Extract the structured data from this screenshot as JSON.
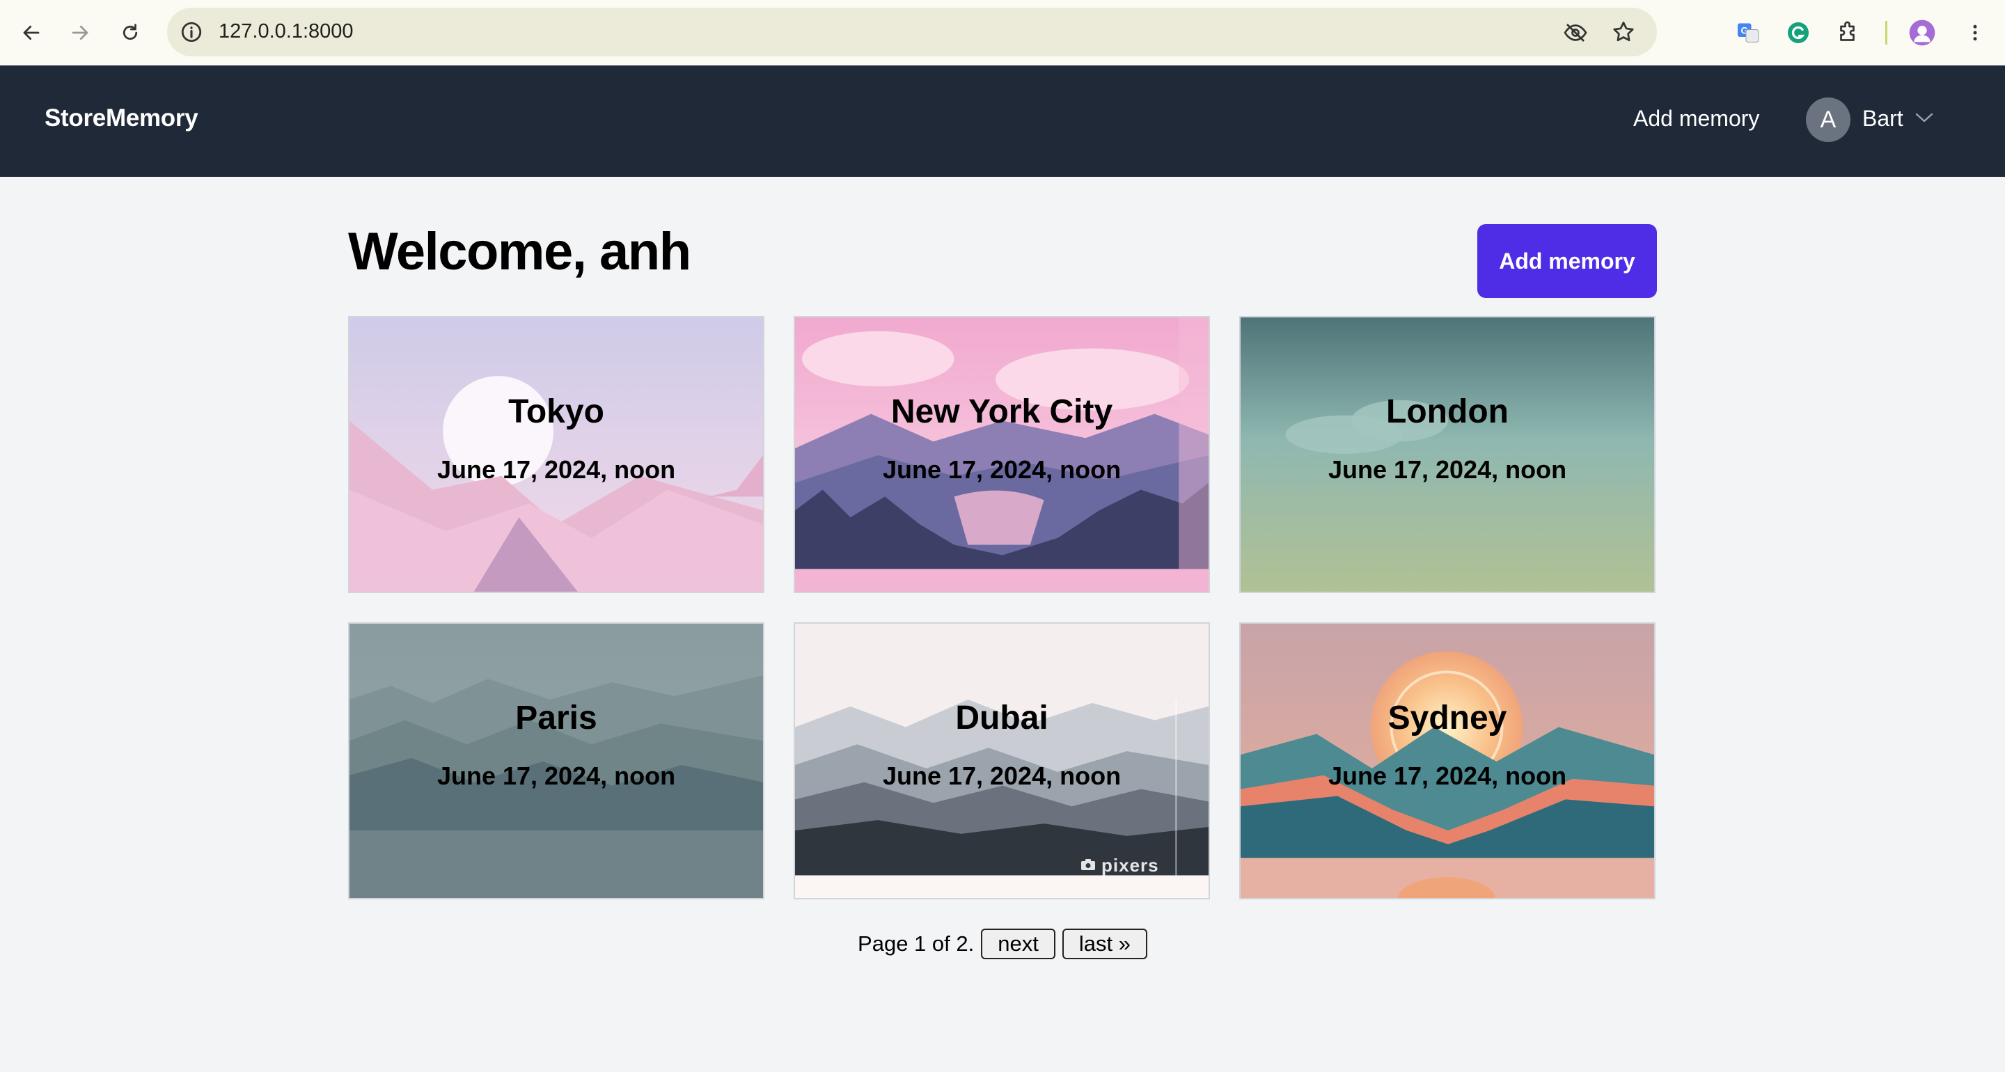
{
  "browser": {
    "url": "127.0.0.1:8000"
  },
  "header": {
    "brand": "StoreMemory",
    "add_memory_link": "Add memory",
    "user_initial": "A",
    "user_name": "Bart"
  },
  "main": {
    "welcome": "Welcome, anh",
    "add_memory_button": "Add memory",
    "accent_color": "#4f2de6"
  },
  "memories": [
    {
      "city": "Tokyo",
      "date": "June 17, 2024, noon"
    },
    {
      "city": "New York City",
      "date": "June 17, 2024, noon"
    },
    {
      "city": "London",
      "date": "June 17, 2024, noon"
    },
    {
      "city": "Paris",
      "date": "June 17, 2024, noon"
    },
    {
      "city": "Dubai",
      "date": "June 17, 2024, noon"
    },
    {
      "city": "Sydney",
      "date": "June 17, 2024, noon"
    }
  ],
  "pagination": {
    "status": "Page 1 of 2.",
    "next_label": "next",
    "last_label": "last »"
  },
  "watermark": "pixers"
}
